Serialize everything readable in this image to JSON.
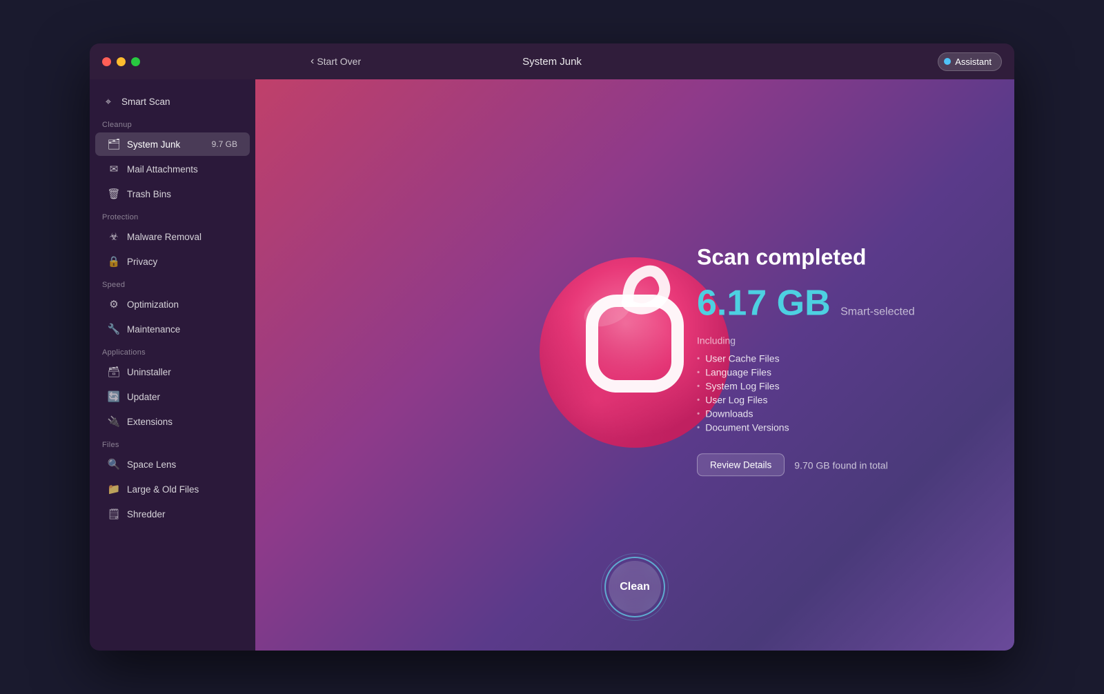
{
  "window": {
    "title": "System Junk"
  },
  "titlebar": {
    "back_label": "Start Over",
    "title": "System Junk",
    "assistant_label": "Assistant"
  },
  "sidebar": {
    "smart_scan_label": "Smart Scan",
    "sections": [
      {
        "label": "Cleanup",
        "items": [
          {
            "id": "system-junk",
            "label": "System Junk",
            "badge": "9.7 GB",
            "active": true,
            "icon": "🗂"
          },
          {
            "id": "mail-attachments",
            "label": "Mail Attachments",
            "badge": "",
            "active": false,
            "icon": "✉"
          },
          {
            "id": "trash-bins",
            "label": "Trash Bins",
            "badge": "",
            "active": false,
            "icon": "🗑"
          }
        ]
      },
      {
        "label": "Protection",
        "items": [
          {
            "id": "malware-removal",
            "label": "Malware Removal",
            "badge": "",
            "active": false,
            "icon": "☣"
          },
          {
            "id": "privacy",
            "label": "Privacy",
            "badge": "",
            "active": false,
            "icon": "🔒"
          }
        ]
      },
      {
        "label": "Speed",
        "items": [
          {
            "id": "optimization",
            "label": "Optimization",
            "badge": "",
            "active": false,
            "icon": "⚙"
          },
          {
            "id": "maintenance",
            "label": "Maintenance",
            "badge": "",
            "active": false,
            "icon": "🔧"
          }
        ]
      },
      {
        "label": "Applications",
        "items": [
          {
            "id": "uninstaller",
            "label": "Uninstaller",
            "badge": "",
            "active": false,
            "icon": "🗃"
          },
          {
            "id": "updater",
            "label": "Updater",
            "badge": "",
            "active": false,
            "icon": "🔄"
          },
          {
            "id": "extensions",
            "label": "Extensions",
            "badge": "",
            "active": false,
            "icon": "🔌"
          }
        ]
      },
      {
        "label": "Files",
        "items": [
          {
            "id": "space-lens",
            "label": "Space Lens",
            "badge": "",
            "active": false,
            "icon": "🔍"
          },
          {
            "id": "large-old-files",
            "label": "Large & Old Files",
            "badge": "",
            "active": false,
            "icon": "📁"
          },
          {
            "id": "shredder",
            "label": "Shredder",
            "badge": "",
            "active": false,
            "icon": "🗒"
          }
        ]
      }
    ]
  },
  "main": {
    "scan_completed": "Scan completed",
    "scan_size": "6.17 GB",
    "smart_selected": "Smart-selected",
    "including_label": "Including",
    "items": [
      "User Cache Files",
      "Language Files",
      "System Log Files",
      "User Log Files",
      "Downloads",
      "Document Versions"
    ],
    "review_details_btn": "Review Details",
    "found_total": "9.70 GB found in total",
    "clean_btn": "Clean"
  }
}
